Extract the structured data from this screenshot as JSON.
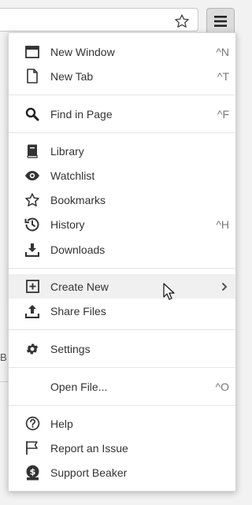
{
  "menu": {
    "groups": [
      [
        {
          "label": "New Window",
          "shortcut": "^N",
          "icon": "window-icon"
        },
        {
          "label": "New Tab",
          "shortcut": "^T",
          "icon": "file-icon"
        }
      ],
      [
        {
          "label": "Find in Page",
          "shortcut": "^F",
          "icon": "search-icon"
        }
      ],
      [
        {
          "label": "Library",
          "shortcut": "",
          "icon": "book-icon"
        },
        {
          "label": "Watchlist",
          "shortcut": "",
          "icon": "eye-icon"
        },
        {
          "label": "Bookmarks",
          "shortcut": "",
          "icon": "star-icon"
        },
        {
          "label": "History",
          "shortcut": "^H",
          "icon": "history-icon"
        },
        {
          "label": "Downloads",
          "shortcut": "",
          "icon": "download-icon"
        }
      ],
      [
        {
          "label": "Create New",
          "shortcut": "",
          "icon": "plus-square-icon",
          "submenu": true,
          "hovered": true
        },
        {
          "label": "Share Files",
          "shortcut": "",
          "icon": "upload-icon"
        }
      ],
      [
        {
          "label": "Settings",
          "shortcut": "",
          "icon": "gear-icon"
        }
      ],
      [
        {
          "label": "Open File...",
          "shortcut": "^O",
          "icon": ""
        }
      ],
      [
        {
          "label": "Help",
          "shortcut": "",
          "icon": "question-circle-icon"
        },
        {
          "label": "Report an Issue",
          "shortcut": "",
          "icon": "flag-icon"
        },
        {
          "label": "Support Beaker",
          "shortcut": "",
          "icon": "dollar-badge-icon"
        }
      ]
    ]
  },
  "background": {
    "fragment_text": "B"
  }
}
